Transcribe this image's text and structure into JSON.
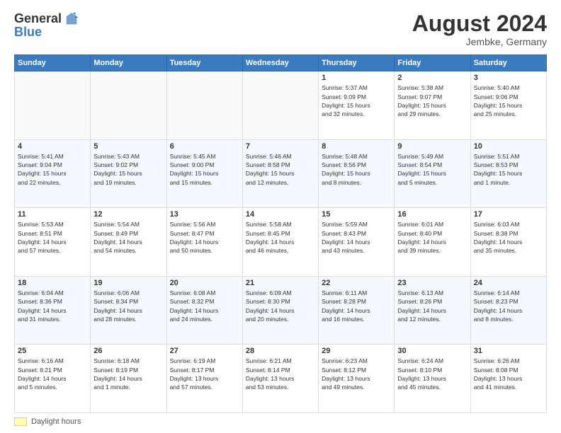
{
  "header": {
    "logo_general": "General",
    "logo_blue": "Blue",
    "month_year": "August 2024",
    "location": "Jembke, Germany"
  },
  "footer": {
    "legend_label": "Daylight hours"
  },
  "days_of_week": [
    "Sunday",
    "Monday",
    "Tuesday",
    "Wednesday",
    "Thursday",
    "Friday",
    "Saturday"
  ],
  "weeks": [
    [
      {
        "day": "",
        "info": ""
      },
      {
        "day": "",
        "info": ""
      },
      {
        "day": "",
        "info": ""
      },
      {
        "day": "",
        "info": ""
      },
      {
        "day": "1",
        "info": "Sunrise: 5:37 AM\nSunset: 9:09 PM\nDaylight: 15 hours\nand 32 minutes."
      },
      {
        "day": "2",
        "info": "Sunrise: 5:38 AM\nSunset: 9:07 PM\nDaylight: 15 hours\nand 29 minutes."
      },
      {
        "day": "3",
        "info": "Sunrise: 5:40 AM\nSunset: 9:06 PM\nDaylight: 15 hours\nand 25 minutes."
      }
    ],
    [
      {
        "day": "4",
        "info": "Sunrise: 5:41 AM\nSunset: 9:04 PM\nDaylight: 15 hours\nand 22 minutes."
      },
      {
        "day": "5",
        "info": "Sunrise: 5:43 AM\nSunset: 9:02 PM\nDaylight: 15 hours\nand 19 minutes."
      },
      {
        "day": "6",
        "info": "Sunrise: 5:45 AM\nSunset: 9:00 PM\nDaylight: 15 hours\nand 15 minutes."
      },
      {
        "day": "7",
        "info": "Sunrise: 5:46 AM\nSunset: 8:58 PM\nDaylight: 15 hours\nand 12 minutes."
      },
      {
        "day": "8",
        "info": "Sunrise: 5:48 AM\nSunset: 8:56 PM\nDaylight: 15 hours\nand 8 minutes."
      },
      {
        "day": "9",
        "info": "Sunrise: 5:49 AM\nSunset: 8:54 PM\nDaylight: 15 hours\nand 5 minutes."
      },
      {
        "day": "10",
        "info": "Sunrise: 5:51 AM\nSunset: 8:53 PM\nDaylight: 15 hours\nand 1 minute."
      }
    ],
    [
      {
        "day": "11",
        "info": "Sunrise: 5:53 AM\nSunset: 8:51 PM\nDaylight: 14 hours\nand 57 minutes."
      },
      {
        "day": "12",
        "info": "Sunrise: 5:54 AM\nSunset: 8:49 PM\nDaylight: 14 hours\nand 54 minutes."
      },
      {
        "day": "13",
        "info": "Sunrise: 5:56 AM\nSunset: 8:47 PM\nDaylight: 14 hours\nand 50 minutes."
      },
      {
        "day": "14",
        "info": "Sunrise: 5:58 AM\nSunset: 8:45 PM\nDaylight: 14 hours\nand 46 minutes."
      },
      {
        "day": "15",
        "info": "Sunrise: 5:59 AM\nSunset: 8:43 PM\nDaylight: 14 hours\nand 43 minutes."
      },
      {
        "day": "16",
        "info": "Sunrise: 6:01 AM\nSunset: 8:40 PM\nDaylight: 14 hours\nand 39 minutes."
      },
      {
        "day": "17",
        "info": "Sunrise: 6:03 AM\nSunset: 8:38 PM\nDaylight: 14 hours\nand 35 minutes."
      }
    ],
    [
      {
        "day": "18",
        "info": "Sunrise: 6:04 AM\nSunset: 8:36 PM\nDaylight: 14 hours\nand 31 minutes."
      },
      {
        "day": "19",
        "info": "Sunrise: 6:06 AM\nSunset: 8:34 PM\nDaylight: 14 hours\nand 28 minutes."
      },
      {
        "day": "20",
        "info": "Sunrise: 6:08 AM\nSunset: 8:32 PM\nDaylight: 14 hours\nand 24 minutes."
      },
      {
        "day": "21",
        "info": "Sunrise: 6:09 AM\nSunset: 8:30 PM\nDaylight: 14 hours\nand 20 minutes."
      },
      {
        "day": "22",
        "info": "Sunrise: 6:11 AM\nSunset: 8:28 PM\nDaylight: 14 hours\nand 16 minutes."
      },
      {
        "day": "23",
        "info": "Sunrise: 6:13 AM\nSunset: 8:26 PM\nDaylight: 14 hours\nand 12 minutes."
      },
      {
        "day": "24",
        "info": "Sunrise: 6:14 AM\nSunset: 8:23 PM\nDaylight: 14 hours\nand 8 minutes."
      }
    ],
    [
      {
        "day": "25",
        "info": "Sunrise: 6:16 AM\nSunset: 8:21 PM\nDaylight: 14 hours\nand 5 minutes."
      },
      {
        "day": "26",
        "info": "Sunrise: 6:18 AM\nSunset: 8:19 PM\nDaylight: 14 hours\nand 1 minute."
      },
      {
        "day": "27",
        "info": "Sunrise: 6:19 AM\nSunset: 8:17 PM\nDaylight: 13 hours\nand 57 minutes."
      },
      {
        "day": "28",
        "info": "Sunrise: 6:21 AM\nSunset: 8:14 PM\nDaylight: 13 hours\nand 53 minutes."
      },
      {
        "day": "29",
        "info": "Sunrise: 6:23 AM\nSunset: 8:12 PM\nDaylight: 13 hours\nand 49 minutes."
      },
      {
        "day": "30",
        "info": "Sunrise: 6:24 AM\nSunset: 8:10 PM\nDaylight: 13 hours\nand 45 minutes."
      },
      {
        "day": "31",
        "info": "Sunrise: 6:26 AM\nSunset: 8:08 PM\nDaylight: 13 hours\nand 41 minutes."
      }
    ]
  ]
}
